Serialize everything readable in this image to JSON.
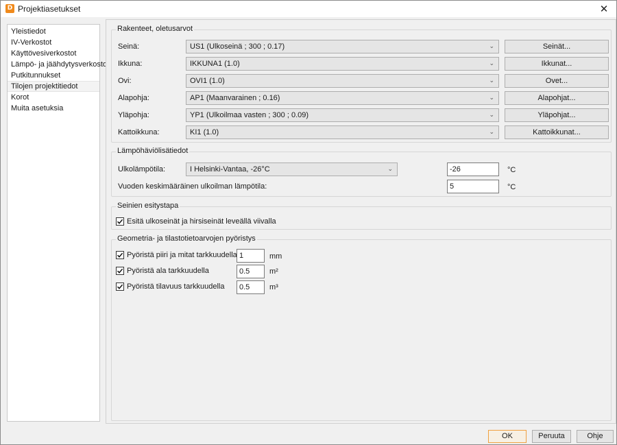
{
  "window": {
    "title": "Projektiasetukset",
    "app_icon_letter": "D"
  },
  "sidebar": {
    "items": [
      {
        "label": "Yleistiedot"
      },
      {
        "label": "IV-Verkostot"
      },
      {
        "label": "Käyttövesiverkostot"
      },
      {
        "label": "Lämpö- ja jäähdytysverkostot"
      },
      {
        "label": "Putkitunnukset"
      },
      {
        "label": "Tilojen projektitiedot",
        "selected": true
      },
      {
        "label": "Korot"
      },
      {
        "label": "Muita asetuksia"
      }
    ]
  },
  "structures": {
    "legend": "Rakenteet, oletusarvot",
    "rows": [
      {
        "label": "Seinä:",
        "value": "US1 (Ulkoseinä ; 300 ; 0.17)",
        "button": "Seinät..."
      },
      {
        "label": "Ikkuna:",
        "value": "IKKUNA1 (1.0)",
        "button": "Ikkunat..."
      },
      {
        "label": "Ovi:",
        "value": "OVI1 (1.0)",
        "button": "Ovet..."
      },
      {
        "label": "Alapohja:",
        "value": "AP1 (Maanvarainen ; 0.16)",
        "button": "Alapohjat..."
      },
      {
        "label": "Yläpohja:",
        "value": "YP1 (Ulkoilmaa vasten ; 300 ; 0.09)",
        "button": "Yläpohjat..."
      },
      {
        "label": "Kattoikkuna:",
        "value": "KI1 (1.0)",
        "button": "Kattoikkunat..."
      }
    ]
  },
  "heatloss": {
    "legend": "Lämpöhäviölisätiedot",
    "outdoor_label": "Ulkolämpötila:",
    "outdoor_location": "I Helsinki-Vantaa, -26°C",
    "outdoor_value": "-26",
    "outdoor_unit": "°C",
    "annual_label": "Vuoden keskimääräinen ulkoilman lämpötila:",
    "annual_value": "5",
    "annual_unit": "°C"
  },
  "walls_display": {
    "legend": "Seinien esitystapa",
    "checkbox_label": "Esitä ulkoseinät ja hirsiseinät leveällä viivalla",
    "checked": true
  },
  "rounding": {
    "legend": "Geometria- ja tilastotietoarvojen pyöristys",
    "rows": [
      {
        "label": "Pyöristä piiri ja mitat tarkkuudella",
        "value": "1",
        "unit": "mm",
        "checked": true
      },
      {
        "label": "Pyöristä ala tarkkuudella",
        "value": "0.5",
        "unit": "m²",
        "checked": true
      },
      {
        "label": "Pyöristä tilavuus tarkkuudella",
        "value": "0.5",
        "unit": "m³",
        "checked": true
      }
    ]
  },
  "footer": {
    "ok": "OK",
    "cancel": "Peruuta",
    "help": "Ohje"
  },
  "colors": {
    "accent_orange": "#f08a1c",
    "default_button_border": "#f0a040"
  }
}
